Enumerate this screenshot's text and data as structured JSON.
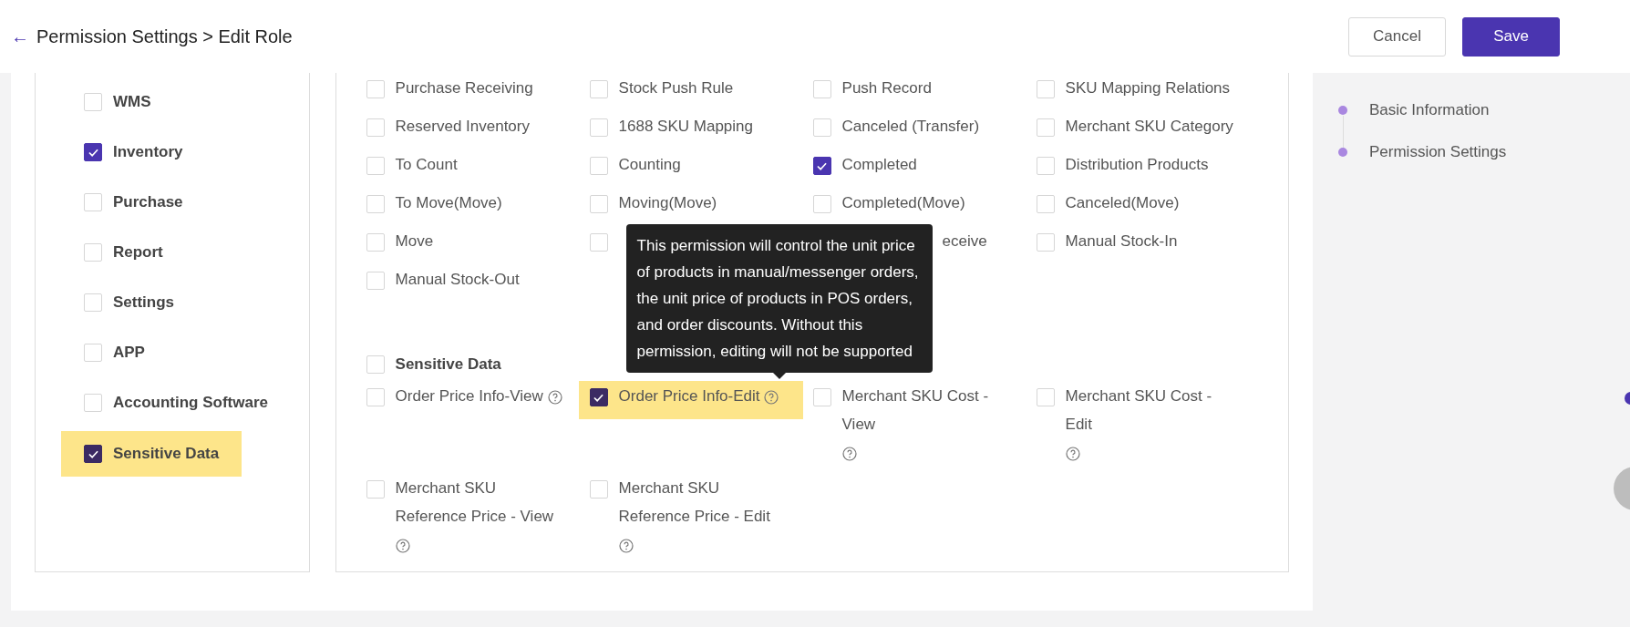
{
  "header": {
    "back": "←",
    "title": "Permission Settings > Edit Role",
    "buttons": [
      {
        "label": "Cancel",
        "kind": "secondary"
      },
      {
        "label": "Save",
        "kind": "primary"
      }
    ]
  },
  "modules": [
    {
      "label": "WMS",
      "checked": false,
      "highlighted": false
    },
    {
      "label": "Inventory",
      "checked": true,
      "highlighted": false
    },
    {
      "label": "Purchase",
      "checked": false,
      "highlighted": false
    },
    {
      "label": "Report",
      "checked": false,
      "highlighted": false
    },
    {
      "label": "Settings",
      "checked": false,
      "highlighted": false
    },
    {
      "label": "APP",
      "checked": false,
      "highlighted": false
    },
    {
      "label": "Accounting Software",
      "checked": false,
      "highlighted": false
    },
    {
      "label": "Sensitive Data",
      "checked": true,
      "highlighted": true
    }
  ],
  "groups": [
    {
      "items": [
        {
          "label": "Purchase Receiving",
          "checked": false
        },
        {
          "label": "Stock Push Rule",
          "checked": false
        },
        {
          "label": "Push Record",
          "checked": false
        },
        {
          "label": "SKU Mapping Relations",
          "checked": false
        },
        {
          "label": "Reserved Inventory",
          "checked": false
        },
        {
          "label": "1688 SKU Mapping",
          "checked": false
        },
        {
          "label": "Canceled (Transfer)",
          "checked": false
        },
        {
          "label": "Merchant SKU Category",
          "checked": false
        },
        {
          "label": "To Count",
          "checked": false
        },
        {
          "label": "Counting",
          "checked": false
        },
        {
          "label": "Completed",
          "checked": true
        },
        {
          "label": "Distribution Products",
          "checked": false
        },
        {
          "label": "To Move(Move)",
          "checked": false
        },
        {
          "label": "Moving(Move)",
          "checked": false
        },
        {
          "label": "Completed(Move)",
          "checked": false
        },
        {
          "label": "Canceled(Move)",
          "checked": false
        },
        {
          "label": "Move",
          "checked": false
        },
        {
          "kind": "box",
          "checked": false
        },
        {
          "kind": "covered",
          "label": "eceive"
        },
        {
          "label": "Manual Stock-In",
          "checked": false
        },
        {
          "label": "Manual Stock-Out",
          "checked": false
        }
      ]
    },
    {
      "title": "Sensitive Data",
      "checked": false,
      "items": [
        {
          "label": "Order Price Info-View",
          "checked": false,
          "help": true
        },
        {
          "label": "Order Price Info-Edit",
          "checked": true,
          "help": true,
          "highlighted": true,
          "tooltip": "This permission will control the unit price of products in manual/messenger orders, the unit price of products in POS orders, and order discounts. Without this permission, editing will not be supported"
        },
        {
          "label": "Merchant SKU Cost - View",
          "checked": false,
          "help": true
        },
        {
          "label": "Merchant SKU Cost - Edit",
          "checked": false,
          "help": true
        },
        {
          "label": "Merchant SKU Reference Price - View",
          "checked": false,
          "help": true
        },
        {
          "label": "Merchant SKU Reference Price - Edit",
          "checked": false,
          "help": true
        }
      ]
    }
  ],
  "steps": [
    {
      "label": "Basic Information"
    },
    {
      "label": "Permission Settings"
    }
  ]
}
